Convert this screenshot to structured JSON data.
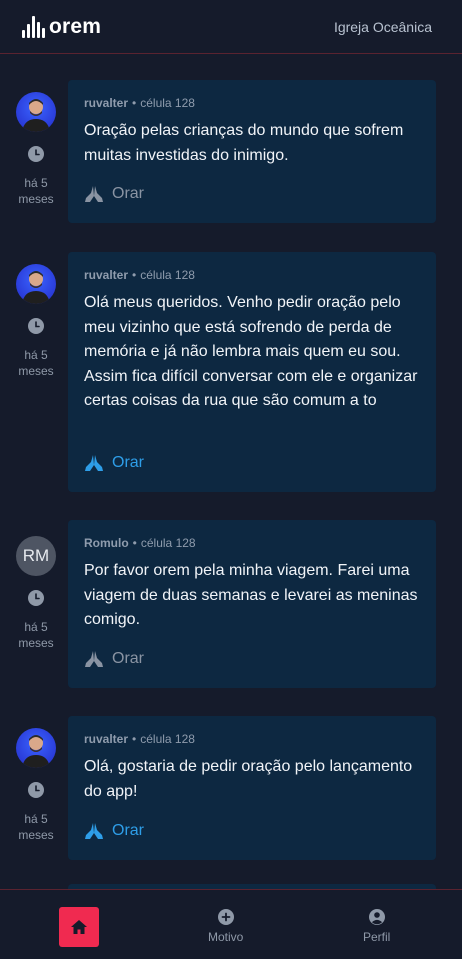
{
  "header": {
    "logo_text": "orem",
    "church_name": "Igreja Oceânica"
  },
  "posts": [
    {
      "author": "ruvalter",
      "group": "célula 128",
      "avatar": "photo",
      "time_ago": "há 5 meses",
      "text": "Oração pelas crianças do mundo que sofrem muitas investidas do inimigo.",
      "pray_label": "Orar",
      "prayed": false
    },
    {
      "author": "ruvalter",
      "group": "célula 128",
      "avatar": "photo",
      "time_ago": "há 5 meses",
      "text": "Olá meus queridos. Venho pedir oração pelo meu vizinho que está sofrendo de perda de memória e já não lembra mais quem eu sou. Assim fica difícil conversar com ele e organizar certas coisas da rua que são comum a to",
      "pray_label": "Orar",
      "prayed": true
    },
    {
      "author": "Romulo",
      "group": "célula 128",
      "avatar_initials": "RM",
      "time_ago": "há 5 meses",
      "text": "Por favor orem pela minha viagem. Farei uma viagem de duas semanas e levarei as meninas comigo.",
      "pray_label": "Orar",
      "prayed": false
    },
    {
      "author": "ruvalter",
      "group": "célula 128",
      "avatar": "photo",
      "time_ago": "há 5 meses",
      "text": "Olá, gostaria de pedir oração pelo lançamento do app!",
      "pray_label": "Orar",
      "prayed": true
    }
  ],
  "bottom_nav": {
    "home_icon": "home-icon",
    "motivo_label": "Motivo",
    "perfil_label": "Perfil"
  },
  "colors": {
    "accent": "#f02a50",
    "prayed": "#2e9ee8",
    "card": "#0d2841",
    "background": "#151b2b"
  }
}
